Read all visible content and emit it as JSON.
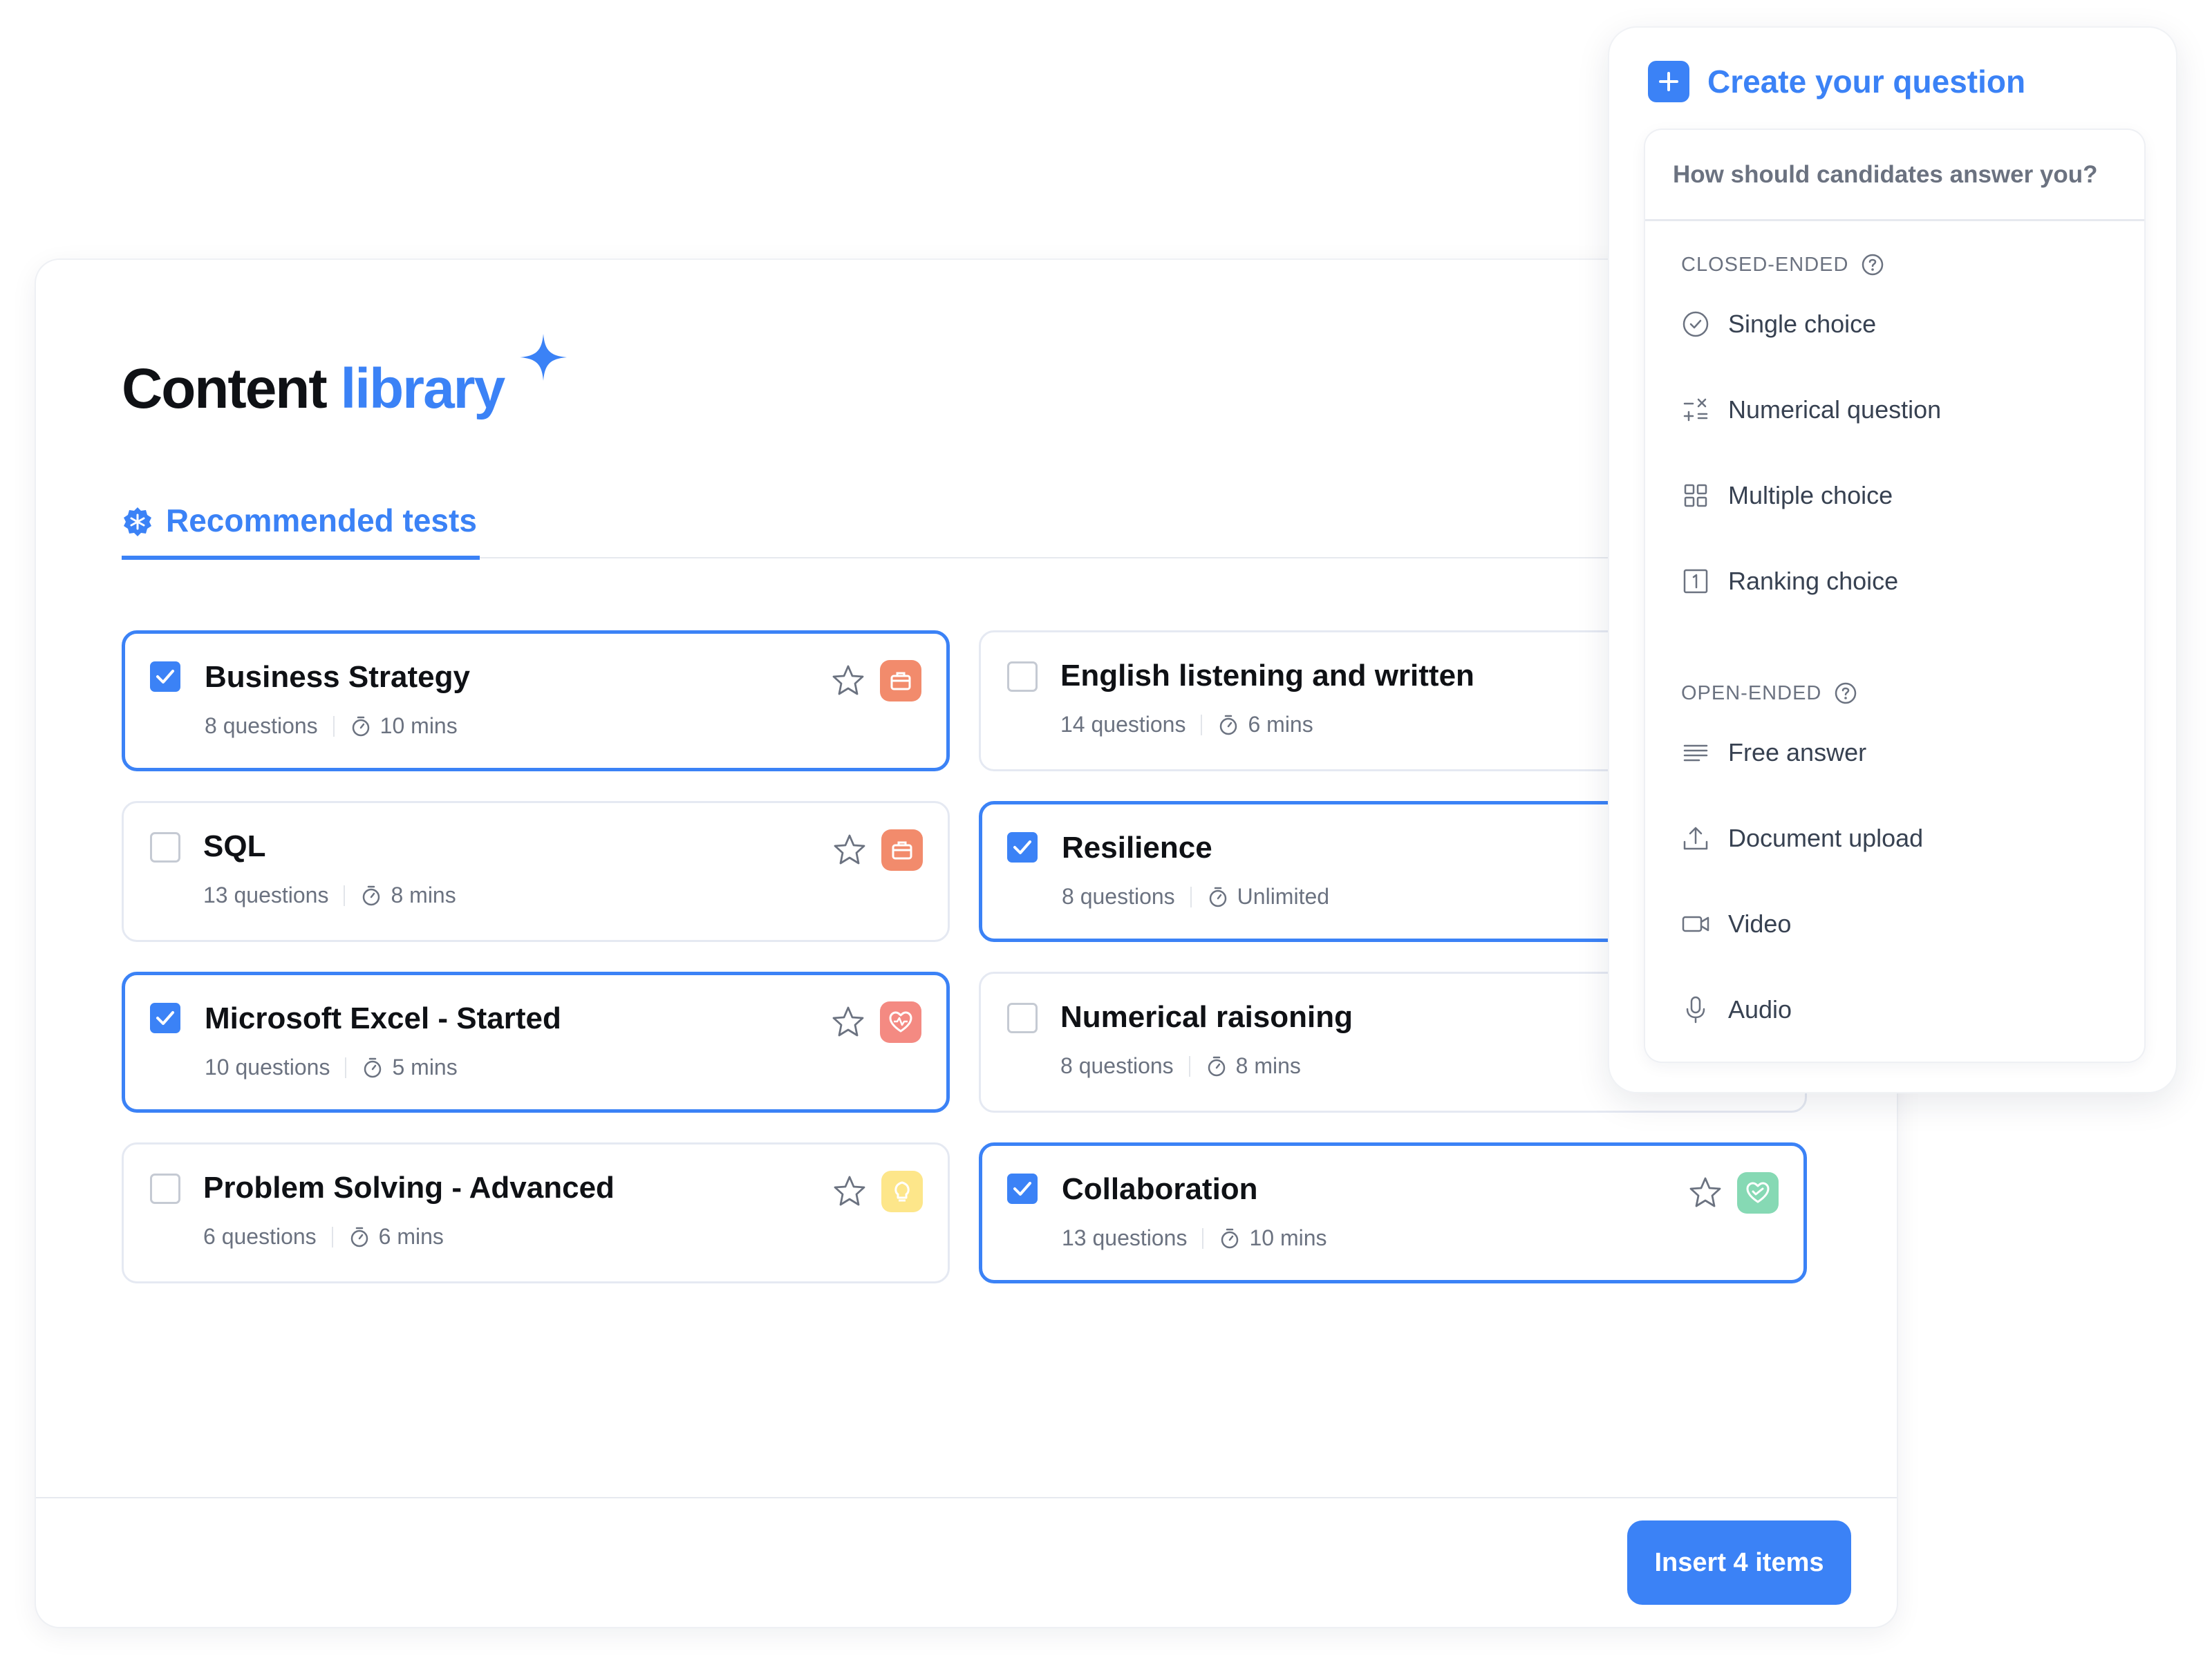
{
  "library": {
    "title_part1": "Content",
    "title_part2": "library",
    "tab_label": "Recommended tests",
    "cards": [
      {
        "title": "Business Strategy",
        "questions": "8 questions",
        "duration": "10 mins",
        "selected": true,
        "category": "briefcase-icon"
      },
      {
        "title": "English listening and written",
        "questions": "14 questions",
        "duration": "6 mins",
        "selected": false,
        "category": "none"
      },
      {
        "title": "SQL",
        "questions": "13 questions",
        "duration": "8 mins",
        "selected": false,
        "category": "briefcase-icon"
      },
      {
        "title": "Resilience",
        "questions": "8 questions",
        "duration": "Unlimited",
        "selected": true,
        "category": "none"
      },
      {
        "title": "Microsoft Excel - Started",
        "questions": "10 questions",
        "duration": "5 mins",
        "selected": true,
        "category": "heartbeat-icon"
      },
      {
        "title": "Numerical raisoning",
        "questions": "8 questions",
        "duration": "8 mins",
        "selected": false,
        "category": "none"
      },
      {
        "title": "Problem Solving - Advanced",
        "questions": "6 questions",
        "duration": "6 mins",
        "selected": false,
        "category": "lightbulb-icon"
      },
      {
        "title": "Collaboration",
        "questions": "13 questions",
        "duration": "10 mins",
        "selected": true,
        "category": "heart-icon"
      }
    ],
    "insert_button": "Insert 4 items"
  },
  "creator": {
    "title": "Create your question",
    "prompt": "How should candidates answer you?",
    "closed_label": "CLOSED-ENDED",
    "closed_options": [
      "Single choice",
      "Numerical question",
      "Multiple choice",
      "Ranking choice"
    ],
    "open_label": "OPEN-ENDED",
    "open_options": [
      "Free answer",
      "Document upload",
      "Video",
      "Audio"
    ]
  },
  "colors": {
    "accent": "#3b82f6",
    "briefcase_badge": "#f28b6c",
    "heartbeat_badge": "#f48a82",
    "lightbulb_badge": "#fde68a",
    "heart_badge": "#86d9b4"
  }
}
